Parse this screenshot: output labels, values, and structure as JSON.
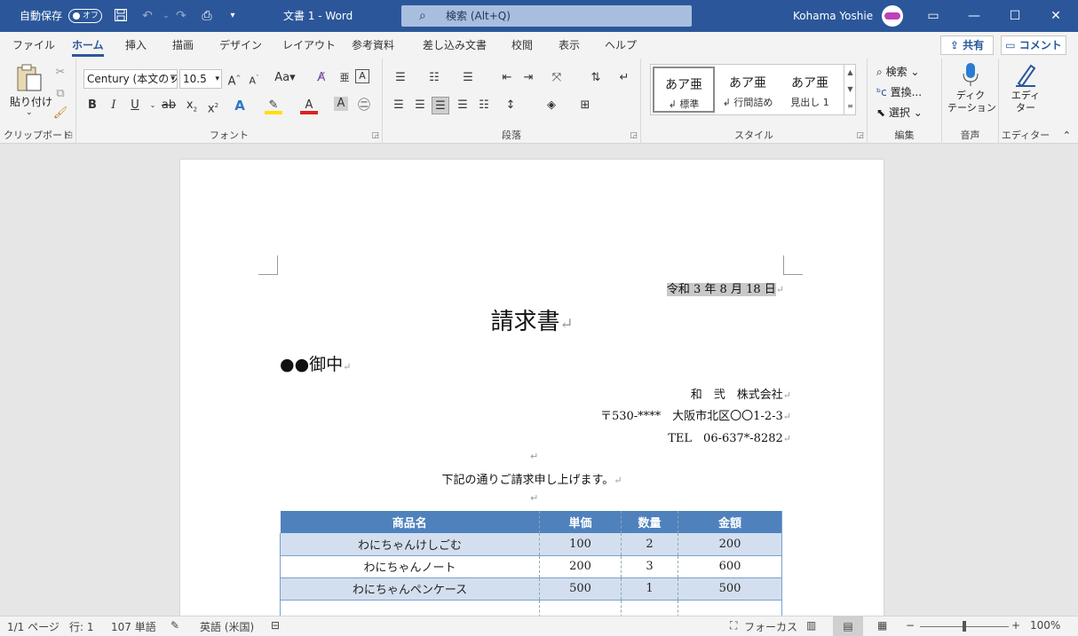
{
  "titlebar": {
    "autosave_label": "自動保存",
    "autosave_state": "オフ",
    "doc_title": "文書 1  -  Word",
    "search_label": "検索 (Alt+Q)",
    "user_name": "Kohama Yoshie"
  },
  "ribbon_tabs": [
    "ファイル",
    "ホーム",
    "挿入",
    "描画",
    "デザイン",
    "レイアウト",
    "参考資料",
    "差し込み文書",
    "校閲",
    "表示",
    "ヘルプ"
  ],
  "active_tab": "ホーム",
  "share_label": "共有",
  "comment_label": "コメント",
  "ribbon": {
    "clipboard": {
      "paste_label": "貼り付け",
      "group_label": "クリップボード"
    },
    "font": {
      "font_name": "Century (本文のフ",
      "font_size": "10.5",
      "aa_label": "Aa",
      "group_label": "フォント"
    },
    "paragraph": {
      "group_label": "段落"
    },
    "styles": {
      "items": [
        {
          "preview": "あア亜",
          "name": "↲ 標準"
        },
        {
          "preview": "あア亜",
          "name": "↲ 行間詰め"
        },
        {
          "preview": "あア亜",
          "name": "見出し 1"
        }
      ],
      "group_label": "スタイル"
    },
    "editing": {
      "find": "検索",
      "replace": "置換...",
      "select": "選択",
      "group_label": "編集"
    },
    "voice": {
      "dictate": "ディク\nテーション",
      "group_label": "音声"
    },
    "editor": {
      "editor": "エディ\nター",
      "group_label": "エディター"
    }
  },
  "document": {
    "date": "令和 3 年 8 月 18 日",
    "title": "請求書",
    "recipient": "●●御中",
    "company": "和　弐　株式会社",
    "address": "〒530-****　大阪市北区〇〇1-2-3",
    "tel": "TEL　06-637*-8282",
    "intro": "下記の通りご請求申し上げます。",
    "table": {
      "headers": [
        "商品名",
        "単価",
        "数量",
        "金額"
      ],
      "rows": [
        [
          "わにちゃんけしごむ",
          "100",
          "2",
          "200"
        ],
        [
          "わにちゃんノート",
          "200",
          "3",
          "600"
        ],
        [
          "わにちゃんペンケース",
          "500",
          "1",
          "500"
        ],
        [
          "",
          "",
          "",
          ""
        ]
      ]
    }
  },
  "statusbar": {
    "page": "1/1 ページ",
    "line": "行: 1",
    "words": "107 単語",
    "language": "英語 (米国)",
    "focus": "フォーカス",
    "zoom": "100%"
  },
  "colors": {
    "accent": "#2b579a",
    "table_header": "#4f81bd",
    "table_band": "#d3dfee"
  }
}
